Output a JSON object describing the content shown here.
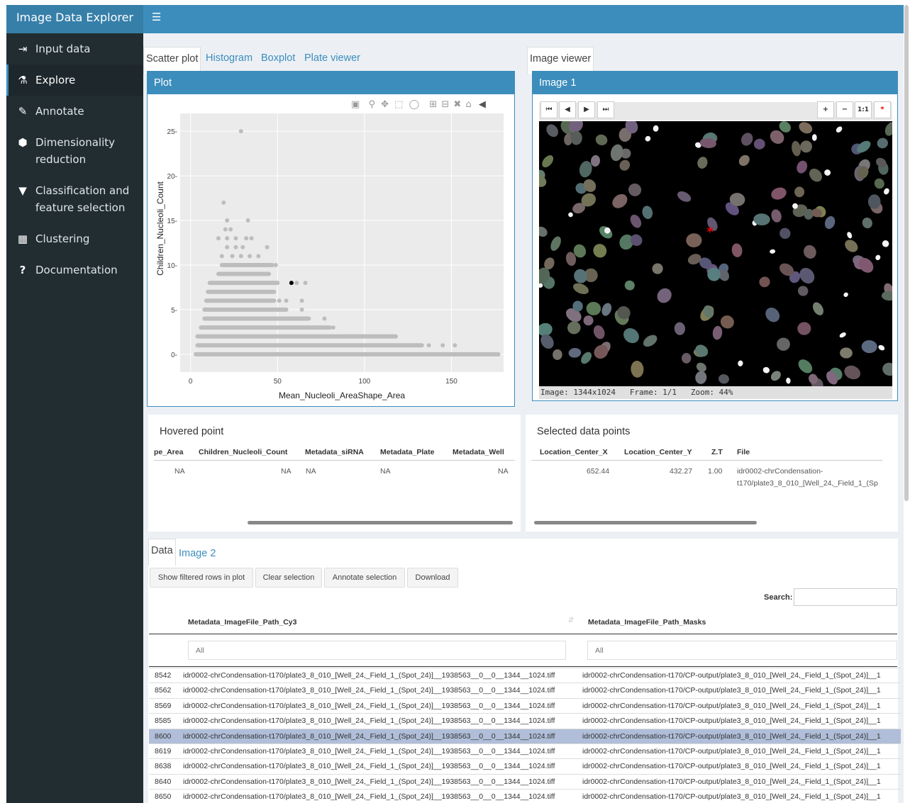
{
  "app": {
    "title": "Image Data Explorer",
    "menu_icon": "hamburger-icon"
  },
  "sidebar": {
    "items": [
      {
        "label": "Input data",
        "icon": "sign-in-icon"
      },
      {
        "label": "Explore",
        "icon": "microscope-icon"
      },
      {
        "label": "Annotate",
        "icon": "edit-icon"
      },
      {
        "label": "Dimensionality reduction",
        "icon": "cube-icon"
      },
      {
        "label": "Classification and feature selection",
        "icon": "filter-icon"
      },
      {
        "label": "Clustering",
        "icon": "object-group-icon"
      },
      {
        "label": "Documentation",
        "icon": "question-icon"
      }
    ],
    "active": "Explore"
  },
  "plot_tabs": [
    "Scatter plot",
    "Histogram",
    "Boxplot",
    "Plate viewer"
  ],
  "plot_box": {
    "title": "Plot"
  },
  "viewer_tabs": [
    "Image viewer"
  ],
  "image_box": {
    "title": "Image 1",
    "status": "Image: 1344x1024   Frame: 1/1   Zoom: 44%",
    "buttons": [
      "⏮",
      "◀",
      "▶",
      "⏭",
      "+",
      "−",
      "1:1",
      "*"
    ]
  },
  "chart_data": {
    "type": "scatter",
    "xlabel": "Mean_Nucleoli_AreaShape_Area",
    "ylabel": "Children_Nucleoli_Count",
    "xlim": [
      -6,
      180
    ],
    "ylim": [
      -2,
      27
    ],
    "xticks": [
      0,
      50,
      100,
      150
    ],
    "yticks": [
      0,
      5,
      10,
      15,
      20,
      25
    ],
    "grid": true,
    "series": [
      {
        "name": "",
        "color": "#bdbdbd",
        "rows": [
          {
            "y": 0,
            "x_from": 3,
            "x_to": 177
          },
          {
            "y": 1,
            "x_from": 4,
            "x_to": 133
          },
          {
            "y": 2,
            "x_from": 4,
            "x_to": 118
          },
          {
            "y": 3,
            "x_from": 6,
            "x_to": 80
          },
          {
            "y": 4,
            "x_from": 8,
            "x_to": 68
          },
          {
            "y": 5,
            "x_from": 8,
            "x_to": 55
          },
          {
            "y": 6,
            "x_from": 9,
            "x_to": 48
          },
          {
            "y": 7,
            "x_from": 10,
            "x_to": 48
          },
          {
            "y": 8,
            "x_from": 11,
            "x_to": 50
          },
          {
            "y": 9,
            "x_from": 16,
            "x_to": 45
          },
          {
            "y": 10,
            "x_from": 18,
            "x_to": 47
          }
        ],
        "points": [
          {
            "x": 51,
            "y": 6
          },
          {
            "x": 55,
            "y": 6
          },
          {
            "x": 58,
            "y": 8
          },
          {
            "x": 61,
            "y": 8
          },
          {
            "x": 66,
            "y": 8
          },
          {
            "x": 64,
            "y": 6
          },
          {
            "x": 64,
            "y": 5
          },
          {
            "x": 77,
            "y": 4
          },
          {
            "x": 82,
            "y": 3
          },
          {
            "x": 92,
            "y": 2
          },
          {
            "x": 97,
            "y": 2
          },
          {
            "x": 103,
            "y": 1
          },
          {
            "x": 108,
            "y": 1
          },
          {
            "x": 113,
            "y": 1
          },
          {
            "x": 119,
            "y": 1
          },
          {
            "x": 137,
            "y": 1
          },
          {
            "x": 145,
            "y": 1
          },
          {
            "x": 152,
            "y": 1
          },
          {
            "x": 49,
            "y": 10
          },
          {
            "x": 44,
            "y": 12
          },
          {
            "x": 18,
            "y": 11
          },
          {
            "x": 24,
            "y": 11
          },
          {
            "x": 29,
            "y": 11
          },
          {
            "x": 34,
            "y": 11
          },
          {
            "x": 39,
            "y": 11
          },
          {
            "x": 21,
            "y": 12
          },
          {
            "x": 26,
            "y": 12
          },
          {
            "x": 30,
            "y": 12
          },
          {
            "x": 16,
            "y": 13
          },
          {
            "x": 21,
            "y": 13
          },
          {
            "x": 26,
            "y": 13
          },
          {
            "x": 32,
            "y": 13
          },
          {
            "x": 35,
            "y": 13
          },
          {
            "x": 20,
            "y": 14
          },
          {
            "x": 23,
            "y": 14
          },
          {
            "x": 21,
            "y": 15
          },
          {
            "x": 33,
            "y": 15
          },
          {
            "x": 19,
            "y": 17
          },
          {
            "x": 29,
            "y": 25
          }
        ]
      },
      {
        "name": "",
        "color": "#000000",
        "points": [
          {
            "x": 58,
            "y": 8
          }
        ]
      }
    ]
  },
  "hovered": {
    "title": "Hovered point",
    "columns": [
      "pe_Area",
      "Children_Nucleoli_Count",
      "Metadata_siRNA",
      "Metadata_Plate",
      "Metadata_Well"
    ],
    "values": [
      "NA",
      "NA",
      "NA",
      "NA",
      "NA"
    ]
  },
  "selected": {
    "title": "Selected data points",
    "columns": [
      "Location_Center_X",
      "Location_Center_Y",
      "Z.T",
      "File"
    ],
    "values": [
      "652.44",
      "432.27",
      "1.00",
      "idr0002-chrCondensation-",
      "t170/plate3_8_010_[Well_24,_Field_1_(Sp"
    ]
  },
  "data_tabs": [
    "Data",
    "Image 2"
  ],
  "buttons": [
    "Show filtered rows in plot",
    "Clear selection",
    "Annotate selection",
    "Download"
  ],
  "search": {
    "label": "Search:",
    "value": ""
  },
  "table": {
    "columns": [
      "Metadata_ImageFile_Path_Cy3",
      "Metadata_ImageFile_Path_Masks"
    ],
    "filter_placeholder": "All",
    "rows": [
      {
        "id": "8542",
        "cy3": "idr0002-chrCondensation-t170/plate3_8_010_[Well_24,_Field_1_(Spot_24)]__1938563__0__0__1344__1024.tiff",
        "masks": "idr0002-chrCondensation-t170/CP-output/plate3_8_010_[Well_24,_Field_1_(Spot_24)]__1"
      },
      {
        "id": "8562",
        "cy3": "idr0002-chrCondensation-t170/plate3_8_010_[Well_24,_Field_1_(Spot_24)]__1938563__0__0__1344__1024.tiff",
        "masks": "idr0002-chrCondensation-t170/CP-output/plate3_8_010_[Well_24,_Field_1_(Spot_24)]__1"
      },
      {
        "id": "8569",
        "cy3": "idr0002-chrCondensation-t170/plate3_8_010_[Well_24,_Field_1_(Spot_24)]__1938563__0__0__1344__1024.tiff",
        "masks": "idr0002-chrCondensation-t170/CP-output/plate3_8_010_[Well_24,_Field_1_(Spot_24)]__1"
      },
      {
        "id": "8585",
        "cy3": "idr0002-chrCondensation-t170/plate3_8_010_[Well_24,_Field_1_(Spot_24)]__1938563__0__0__1344__1024.tiff",
        "masks": "idr0002-chrCondensation-t170/CP-output/plate3_8_010_[Well_24,_Field_1_(Spot_24)]__1"
      },
      {
        "id": "8600",
        "cy3": "idr0002-chrCondensation-t170/plate3_8_010_[Well_24,_Field_1_(Spot_24)]__1938563__0__0__1344__1024.tiff",
        "masks": "idr0002-chrCondensation-t170/CP-output/plate3_8_010_[Well_24,_Field_1_(Spot_24)]__1",
        "selected": true
      },
      {
        "id": "8619",
        "cy3": "idr0002-chrCondensation-t170/plate3_8_010_[Well_24,_Field_1_(Spot_24)]__1938563__0__0__1344__1024.tiff",
        "masks": "idr0002-chrCondensation-t170/CP-output/plate3_8_010_[Well_24,_Field_1_(Spot_24)]__1"
      },
      {
        "id": "8638",
        "cy3": "idr0002-chrCondensation-t170/plate3_8_010_[Well_24,_Field_1_(Spot_24)]__1938563__0__0__1344__1024.tiff",
        "masks": "idr0002-chrCondensation-t170/CP-output/plate3_8_010_[Well_24,_Field_1_(Spot_24)]__1"
      },
      {
        "id": "8640",
        "cy3": "idr0002-chrCondensation-t170/plate3_8_010_[Well_24,_Field_1_(Spot_24)]__1938563__0__0__1344__1024.tiff",
        "masks": "idr0002-chrCondensation-t170/CP-output/plate3_8_010_[Well_24,_Field_1_(Spot_24)]__1"
      },
      {
        "id": "8650",
        "cy3": "idr0002-chrCondensation-t170/plate3_8_010_[Well_24,_Field_1_(Spot_24)]__1938563__0__0__1344__1024.tiff",
        "masks": "idr0002-chrCondensation-t170/CP-output/plate3_8_010_[Well_24,_Field_1_(Spot_24)]__1"
      }
    ]
  }
}
